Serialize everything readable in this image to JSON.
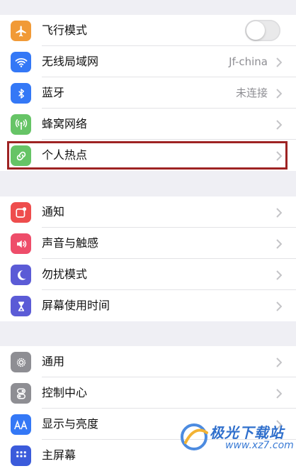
{
  "groups": [
    {
      "rows": [
        {
          "label": "飞行模式",
          "icon": "airplane-icon",
          "color": "#f19a37",
          "type": "toggle",
          "toggle_on": false
        },
        {
          "label": "无线局域网",
          "icon": "wifi-icon",
          "color": "#3478f6",
          "type": "value",
          "value": "Jf-china"
        },
        {
          "label": "蓝牙",
          "icon": "bluetooth-icon",
          "color": "#3478f6",
          "type": "value",
          "value": "未连接"
        },
        {
          "label": "蜂窝网络",
          "icon": "antenna-icon",
          "color": "#66c466",
          "type": "chevron"
        },
        {
          "label": "个人热点",
          "icon": "hotspot-icon",
          "color": "#66c466",
          "type": "chevron",
          "highlighted": true
        }
      ]
    },
    {
      "rows": [
        {
          "label": "通知",
          "icon": "notifications-icon",
          "color": "#ee4d4d",
          "type": "chevron"
        },
        {
          "label": "声音与触感",
          "icon": "speaker-icon",
          "color": "#ee4d6a",
          "type": "chevron"
        },
        {
          "label": "勿扰模式",
          "icon": "moon-icon",
          "color": "#5b5bd6",
          "type": "chevron"
        },
        {
          "label": "屏幕使用时间",
          "icon": "hourglass-icon",
          "color": "#5b5bd6",
          "type": "chevron"
        }
      ]
    },
    {
      "rows": [
        {
          "label": "通用",
          "icon": "gear-icon",
          "color": "#8e8e93",
          "type": "chevron"
        },
        {
          "label": "控制中心",
          "icon": "switches-icon",
          "color": "#8e8e93",
          "type": "chevron"
        },
        {
          "label": "显示与亮度",
          "icon": "text-size-icon",
          "color": "#3478f6",
          "type": "chevron"
        },
        {
          "label": "主屏幕",
          "icon": "home-grid-icon",
          "color": "#3b5bdb",
          "type": "chevron"
        }
      ]
    }
  ],
  "watermark": {
    "title": "极光下载站",
    "url": "www.xz7.com"
  }
}
